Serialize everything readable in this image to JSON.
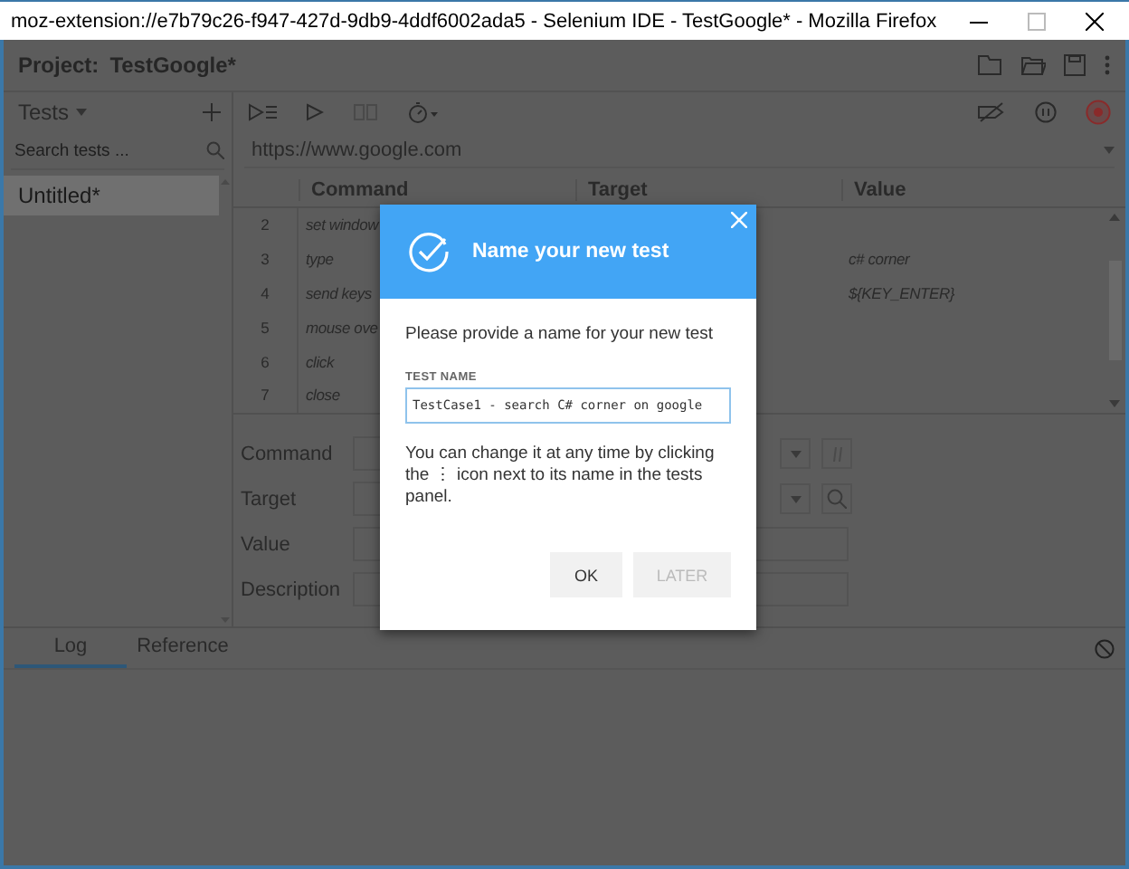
{
  "window": {
    "title": "moz-extension://e7b79c26-f947-427d-9db9-4ddf6002ada5 - Selenium IDE - TestGoogle* - Mozilla Firefox"
  },
  "project": {
    "label": "Project:",
    "name": "TestGoogle*"
  },
  "tests_panel": {
    "title": "Tests",
    "search_placeholder": "Search tests ...",
    "items": [
      {
        "name": "Untitled*",
        "selected": true
      }
    ]
  },
  "url": "https://www.google.com",
  "table": {
    "columns": [
      "Command",
      "Target",
      "Value"
    ],
    "rows": [
      {
        "number": "2",
        "command": "set window"
      },
      {
        "number": "3",
        "command": "type",
        "value": "c# corner"
      },
      {
        "number": "4",
        "command": "send keys",
        "value": "${KEY_ENTER}"
      },
      {
        "number": "5",
        "command": "mouse ove"
      },
      {
        "number": "6",
        "command": "click"
      },
      {
        "number": "7",
        "command": "close"
      }
    ]
  },
  "editor": {
    "fields": [
      {
        "label": "Command",
        "kind": "command"
      },
      {
        "label": "Target",
        "kind": "target"
      },
      {
        "label": "Value",
        "kind": "text"
      },
      {
        "label": "Description",
        "kind": "text"
      }
    ]
  },
  "log_tabs": [
    {
      "label": "Log",
      "selected": true
    },
    {
      "label": "Reference",
      "selected": false
    }
  ],
  "dialog": {
    "title": "Name your new test",
    "prompt": "Please provide a name for your new test",
    "field_label": "TEST NAME",
    "value": "TestCase1 - search C# corner on google",
    "hint": "You can change it at any time by clicking the ⋮ icon next to its name in the tests panel.",
    "buttons": [
      {
        "label": "OK",
        "disabled": false
      },
      {
        "label": "LATER",
        "disabled": true
      }
    ]
  }
}
